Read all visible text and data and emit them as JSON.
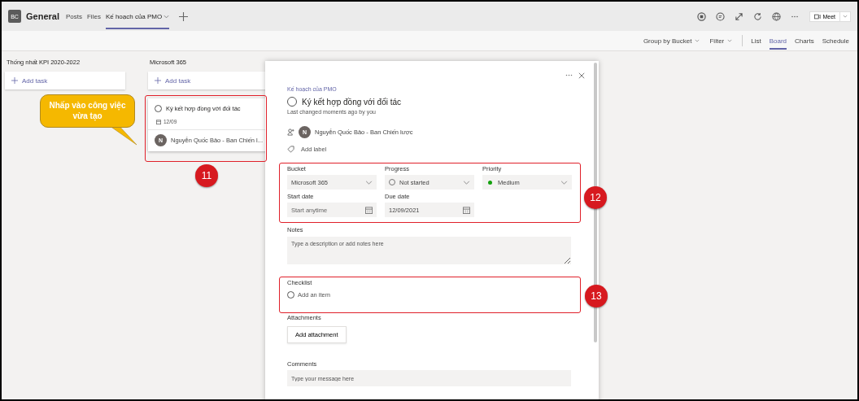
{
  "header": {
    "team_initials": "BC",
    "team": "General",
    "tabs": [
      {
        "label": "Posts",
        "selected": false
      },
      {
        "label": "Files",
        "selected": false
      },
      {
        "label": "Kế hoạch của PMO",
        "selected": true
      }
    ],
    "meet": "Meet"
  },
  "toolbar": {
    "group_by": "Group by Bucket",
    "filter": "Filter",
    "views": [
      {
        "label": "List",
        "selected": false
      },
      {
        "label": "Board",
        "selected": true
      },
      {
        "label": "Charts",
        "selected": false
      },
      {
        "label": "Schedule",
        "selected": false
      }
    ]
  },
  "buckets": [
    {
      "name": "Thống nhất KPI 2020-2022",
      "add_task": "Add task"
    },
    {
      "name": "Microsoft 365",
      "add_task": "Add task",
      "tasks": [
        {
          "title": "Ký kết hợp đồng với đối tác",
          "completed": false,
          "due": "12/09",
          "assignee_initial": "N",
          "assignee": "Nguyễn Quốc Bảo - Ban Chiến l..."
        }
      ]
    }
  ],
  "task_detail": {
    "plan": "Kế hoạch của PMO",
    "title": "Ký kết hợp đồng với đối tác",
    "completed": false,
    "last_changed": "Last changed moments ago by you",
    "assignee_initial": "N",
    "assignee": "Nguyễn Quốc Bảo - Ban Chiến lược",
    "add_label": "Add label",
    "fields": [
      {
        "label": "Bucket",
        "value": "Microsoft 365",
        "kind": "select"
      },
      {
        "label": "Progress",
        "value": "Not started",
        "kind": "progress"
      },
      {
        "label": "Priority",
        "value": "Medium",
        "kind": "priority",
        "color": "#13a10e"
      },
      {
        "label": "Start date",
        "placeholder": "Start anytime",
        "kind": "date"
      },
      {
        "label": "Due date",
        "value": "12/09/2021",
        "kind": "date"
      }
    ],
    "notes_label": "Notes",
    "notes_placeholder": "Type a description or add notes here",
    "checklist_label": "Checklist",
    "checklist_placeholder": "Add an item",
    "checklist_checked": false,
    "attachments_label": "Attachments",
    "add_attachment": "Add attachment",
    "comments_label": "Comments",
    "comments_placeholder": "Type your message here"
  },
  "annotations": {
    "callout": "Nhấp vào công việc vừa tạo",
    "markers": [
      "11",
      "12",
      "13"
    ]
  }
}
